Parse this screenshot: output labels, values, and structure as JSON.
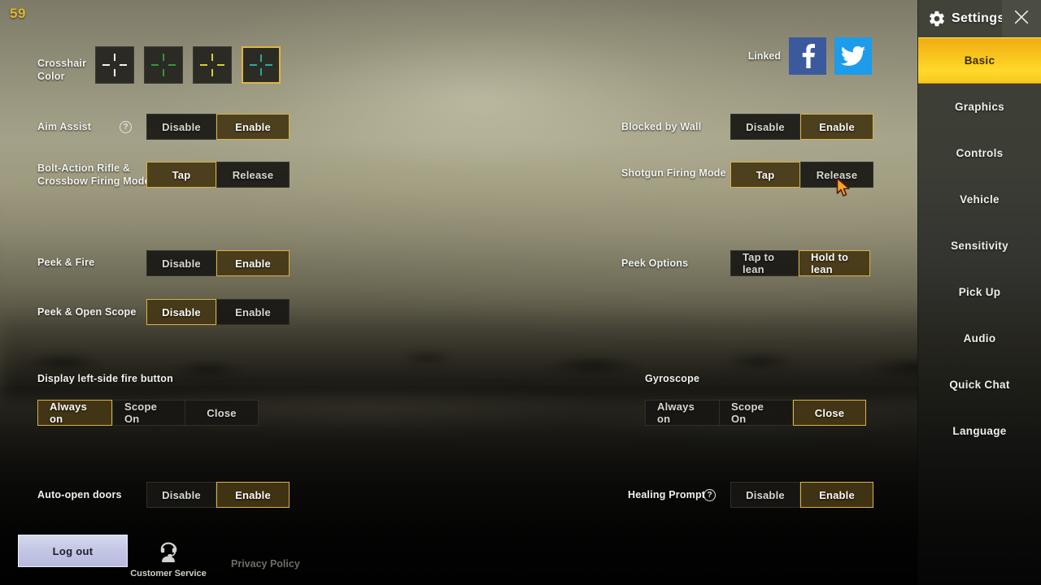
{
  "hud": {
    "fps": "59"
  },
  "crosshair": {
    "label": "Crosshair Color",
    "options": [
      {
        "name": "white",
        "color": "#f2f2f2",
        "selected": false
      },
      {
        "name": "green",
        "color": "#2f9b33",
        "selected": false
      },
      {
        "name": "yellow",
        "color": "#d9cd35",
        "selected": false
      },
      {
        "name": "cyan",
        "color": "#2aa9a2",
        "selected": true
      }
    ]
  },
  "linked": {
    "label": "Linked",
    "facebook": "facebook-icon",
    "twitter": "twitter-icon",
    "facebook_color": "#3b5a9e",
    "twitter_color": "#1c9ceb"
  },
  "settings_left": [
    {
      "key": "aim_assist",
      "label": "Aim Assist",
      "help": "?",
      "options": [
        "Disable",
        "Enable"
      ],
      "selected": "Enable"
    },
    {
      "key": "bolt_action",
      "label": "Bolt-Action Rifle &\nCrossbow Firing Mode",
      "options": [
        "Tap",
        "Release"
      ],
      "selected": "Tap"
    },
    {
      "key": "peek_fire",
      "label": "Peek & Fire",
      "options": [
        "Disable",
        "Enable"
      ],
      "selected": "Enable"
    },
    {
      "key": "peek_open_scope",
      "label": "Peek & Open Scope",
      "options": [
        "Disable",
        "Enable"
      ],
      "selected": "Disable"
    },
    {
      "key": "left_fire_button",
      "label": "Display left-side fire button",
      "options": [
        "Always on",
        "Scope On",
        "Close"
      ],
      "selected": "Always on"
    },
    {
      "key": "auto_open_doors",
      "label": "Auto-open doors",
      "options": [
        "Disable",
        "Enable"
      ],
      "selected": "Enable"
    }
  ],
  "settings_right": [
    {
      "key": "blocked_by_wall",
      "label": "Blocked by Wall",
      "options": [
        "Disable",
        "Enable"
      ],
      "selected": "Enable"
    },
    {
      "key": "shotgun_firing_mode",
      "label": "Shotgun Firing Mode",
      "options": [
        "Tap",
        "Release"
      ],
      "selected": "Tap"
    },
    {
      "key": "peek_options",
      "label": "Peek Options",
      "options": [
        "Tap to lean",
        "Hold to lean"
      ],
      "selected": "Hold to lean"
    },
    {
      "key": "gyroscope",
      "label": "Gyroscope",
      "options": [
        "Always on",
        "Scope On",
        "Close"
      ],
      "selected": "Close"
    },
    {
      "key": "healing_prompt",
      "label": "Healing Prompt",
      "help": "?",
      "options": [
        "Disable",
        "Enable"
      ],
      "selected": "Enable"
    }
  ],
  "footer": {
    "logout": "Log out",
    "customer_service": "Customer Service",
    "privacy_policy": "Privacy Policy"
  },
  "sidebar": {
    "title": "Settings",
    "gear_icon": "gear-icon",
    "close_icon": "close-icon",
    "items": [
      {
        "label": "Basic",
        "active": true
      },
      {
        "label": "Graphics",
        "active": false
      },
      {
        "label": "Controls",
        "active": false
      },
      {
        "label": "Vehicle",
        "active": false
      },
      {
        "label": "Sensitivity",
        "active": false
      },
      {
        "label": "Pick Up",
        "active": false
      },
      {
        "label": "Audio",
        "active": false
      },
      {
        "label": "Quick Chat",
        "active": false
      },
      {
        "label": "Language",
        "active": false
      }
    ]
  },
  "colors": {
    "accent_gold": "#d8b347",
    "active_tab": "#ffd92b",
    "selected_fill": "#453716"
  }
}
